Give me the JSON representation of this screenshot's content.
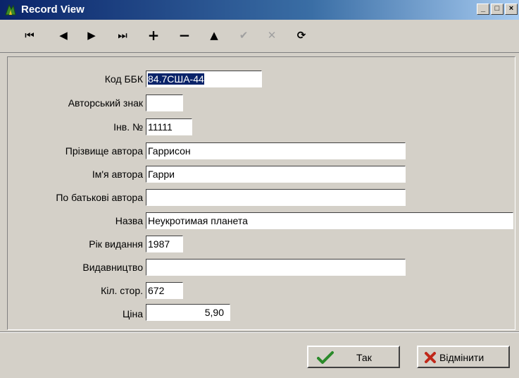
{
  "window": {
    "title": "Record View",
    "minimize_label": "_",
    "maximize_label": "□",
    "close_label": "×"
  },
  "toolbar": {
    "first": "⏮",
    "prior": "◀",
    "next": "▶",
    "last": "⏭",
    "insert": "+",
    "delete": "−",
    "edit": "▲",
    "post": "✔",
    "cancel": "✕",
    "refresh": "⟳"
  },
  "fields": {
    "kod_bbk": {
      "label": "Код ББК",
      "value": "84.7США-44"
    },
    "avtorskyi_znak": {
      "label": "Авторський знак",
      "value": ""
    },
    "inv_no": {
      "label": "Інв. №",
      "value": "11111"
    },
    "surname": {
      "label": "Прізвище автора",
      "value": "Гаррисон"
    },
    "name": {
      "label": "Ім'я автора",
      "value": "Гарри"
    },
    "patronymic": {
      "label": "По батькові автора",
      "value": ""
    },
    "title": {
      "label": "Назва",
      "value": "Неукротимая планета"
    },
    "year": {
      "label": "Рік видання",
      "value": "1987"
    },
    "publisher": {
      "label": "Видавництво",
      "value": ""
    },
    "pages": {
      "label": "Кіл. стор.",
      "value": "672"
    },
    "price": {
      "label": "Ціна",
      "value": "5,90"
    }
  },
  "buttons": {
    "ok": {
      "label": "Так",
      "icon": "check-icon",
      "color": "#2a8a2a"
    },
    "cancel": {
      "label": "Відмінити",
      "icon": "x-icon",
      "color": "#c0281a"
    }
  }
}
